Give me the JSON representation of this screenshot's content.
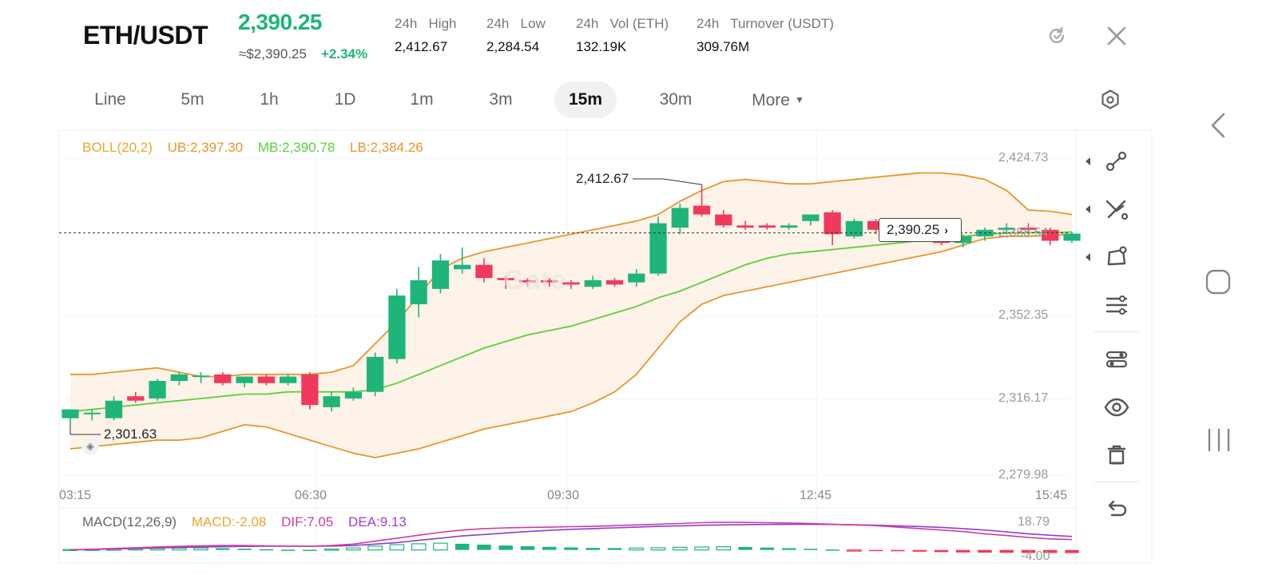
{
  "header": {
    "pair": "ETH/USDT",
    "price": "2,390.25",
    "price_usd": "≈$2,390.25",
    "change": "+2.34%",
    "stats": [
      {
        "label": "24h   High",
        "value": "2,412.67"
      },
      {
        "label": "24h   Low",
        "value": "2,284.54"
      },
      {
        "label": "24h   Vol (ETH)",
        "value": "132.19K"
      },
      {
        "label": "24h   Turnover (USDT)",
        "value": "309.76M"
      }
    ],
    "icons": {
      "refresh": "refresh-icon",
      "close": "close-icon"
    }
  },
  "tabs": [
    {
      "label": "Line",
      "active": false
    },
    {
      "label": "5m",
      "active": false
    },
    {
      "label": "1h",
      "active": false
    },
    {
      "label": "1D",
      "active": false
    },
    {
      "label": "1m",
      "active": false
    },
    {
      "label": "3m",
      "active": false
    },
    {
      "label": "15m",
      "active": true
    },
    {
      "label": "30m",
      "active": false
    },
    {
      "label": "More",
      "active": false
    }
  ],
  "boll": {
    "title": "BOLL(20,2)",
    "ub": "UB:2,397.30",
    "mb": "MB:2,390.78",
    "lb": "LB:2,384.26"
  },
  "macd": {
    "title": "MACD(12,26,9)",
    "macd": "MACD:-2.08",
    "dif": "DIF:7.05",
    "dea": "DEA:9.13",
    "axis_top": "18.79",
    "axis_bottom": "-4.00"
  },
  "price_axis": [
    "2,424.73",
    "2,352.35",
    "2,316.17",
    "2,279.98"
  ],
  "time_axis": [
    "03:15",
    "06:30",
    "09:30",
    "12:45",
    "15:45"
  ],
  "annotations": {
    "high": "2,412.67",
    "low": "2,301.63",
    "current": "2,390.25",
    "current_axis": "2,388.54",
    "watermark": "Gate"
  },
  "colors": {
    "up": "#1fb479",
    "down": "#f0395b",
    "ub": "#e8962a",
    "mb": "#5ccf3a",
    "lb": "#e8962a",
    "band_fill": "#fdf1e5",
    "dif": "#d13aa0",
    "dea": "#8b3fd1",
    "macd_label": "#e8a82a"
  },
  "chart_data": {
    "type": "candlestick",
    "interval": "15m",
    "y_range": [
      2279.98,
      2424.73
    ],
    "candles": [
      {
        "o": 2306,
        "h": 2308,
        "l": 2301.63,
        "c": 2310
      },
      {
        "o": 2308,
        "h": 2310,
        "l": 2305,
        "c": 2308.5
      },
      {
        "o": 2306,
        "h": 2316,
        "l": 2305,
        "c": 2314
      },
      {
        "o": 2316,
        "h": 2318,
        "l": 2313,
        "c": 2314
      },
      {
        "o": 2315,
        "h": 2324,
        "l": 2314,
        "c": 2323
      },
      {
        "o": 2323,
        "h": 2327,
        "l": 2321,
        "c": 2326
      },
      {
        "o": 2325,
        "h": 2327,
        "l": 2322,
        "c": 2325.5
      },
      {
        "o": 2326,
        "h": 2327,
        "l": 2321,
        "c": 2322
      },
      {
        "o": 2322,
        "h": 2325,
        "l": 2320,
        "c": 2325
      },
      {
        "o": 2325,
        "h": 2326,
        "l": 2321,
        "c": 2322
      },
      {
        "o": 2322,
        "h": 2326,
        "l": 2321,
        "c": 2325
      },
      {
        "o": 2326,
        "h": 2327,
        "l": 2310,
        "c": 2312
      },
      {
        "o": 2311,
        "h": 2318,
        "l": 2309,
        "c": 2316
      },
      {
        "o": 2315,
        "h": 2320,
        "l": 2314,
        "c": 2318
      },
      {
        "o": 2318,
        "h": 2336,
        "l": 2316,
        "c": 2334
      },
      {
        "o": 2333,
        "h": 2365,
        "l": 2331,
        "c": 2362
      },
      {
        "o": 2358,
        "h": 2375,
        "l": 2352,
        "c": 2369
      },
      {
        "o": 2365,
        "h": 2381,
        "l": 2363,
        "c": 2378
      },
      {
        "o": 2374,
        "h": 2384,
        "l": 2372,
        "c": 2376
      },
      {
        "o": 2376,
        "h": 2379,
        "l": 2368,
        "c": 2370
      },
      {
        "o": 2370,
        "h": 2371,
        "l": 2365,
        "c": 2369
      },
      {
        "o": 2369,
        "h": 2370,
        "l": 2366,
        "c": 2368
      },
      {
        "o": 2369,
        "h": 2370,
        "l": 2366,
        "c": 2368
      },
      {
        "o": 2368,
        "h": 2369,
        "l": 2365,
        "c": 2367
      },
      {
        "o": 2366,
        "h": 2371,
        "l": 2365,
        "c": 2369
      },
      {
        "o": 2369,
        "h": 2370,
        "l": 2366,
        "c": 2367
      },
      {
        "o": 2368,
        "h": 2374,
        "l": 2366,
        "c": 2372
      },
      {
        "o": 2372,
        "h": 2398,
        "l": 2371,
        "c": 2395
      },
      {
        "o": 2393,
        "h": 2404,
        "l": 2390,
        "c": 2402
      },
      {
        "o": 2403,
        "h": 2412.67,
        "l": 2398,
        "c": 2399
      },
      {
        "o": 2399,
        "h": 2401,
        "l": 2393,
        "c": 2394
      },
      {
        "o": 2394,
        "h": 2396,
        "l": 2392,
        "c": 2393
      },
      {
        "o": 2394,
        "h": 2395,
        "l": 2392,
        "c": 2393
      },
      {
        "o": 2393,
        "h": 2395,
        "l": 2392,
        "c": 2394
      },
      {
        "o": 2396,
        "h": 2399,
        "l": 2394,
        "c": 2399
      },
      {
        "o": 2400,
        "h": 2401,
        "l": 2385,
        "c": 2390
      },
      {
        "o": 2389,
        "h": 2397,
        "l": 2388,
        "c": 2396
      },
      {
        "o": 2396,
        "h": 2397,
        "l": 2390,
        "c": 2392
      },
      {
        "o": 2392,
        "h": 2394,
        "l": 2390,
        "c": 2393
      },
      {
        "o": 2392,
        "h": 2393,
        "l": 2389,
        "c": 2392
      },
      {
        "o": 2392,
        "h": 2393,
        "l": 2385,
        "c": 2386
      },
      {
        "o": 2386,
        "h": 2390,
        "l": 2384,
        "c": 2389
      },
      {
        "o": 2389,
        "h": 2393,
        "l": 2387,
        "c": 2392
      },
      {
        "o": 2392,
        "h": 2395,
        "l": 2390,
        "c": 2393
      },
      {
        "o": 2393,
        "h": 2395,
        "l": 2390,
        "c": 2392
      },
      {
        "o": 2392,
        "h": 2393,
        "l": 2385,
        "c": 2387
      },
      {
        "o": 2387,
        "h": 2391,
        "l": 2386,
        "c": 2390.25
      }
    ],
    "upper_band": [
      2326,
      2326,
      2327,
      2328,
      2329,
      2327,
      2325,
      2325,
      2326,
      2326,
      2326,
      2326,
      2327,
      2330,
      2340,
      2350,
      2362,
      2374,
      2379,
      2382,
      2384,
      2386,
      2388,
      2390,
      2392,
      2394,
      2396,
      2399,
      2405,
      2410,
      2414,
      2415,
      2414,
      2413,
      2413,
      2414,
      2415,
      2416,
      2417,
      2418,
      2418,
      2417,
      2415,
      2410,
      2401,
      2400.5,
      2399
    ],
    "middle_band": [
      2309,
      2310,
      2311,
      2312,
      2313,
      2314,
      2315,
      2316,
      2317,
      2317,
      2318,
      2318,
      2318,
      2318,
      2319,
      2322,
      2326,
      2330,
      2334,
      2338,
      2341,
      2344,
      2346,
      2348,
      2351,
      2354,
      2357,
      2361,
      2364,
      2368,
      2372,
      2376,
      2379,
      2381,
      2382,
      2383,
      2384,
      2385,
      2386,
      2387,
      2388,
      2389,
      2390,
      2390.5,
      2390.8,
      2390.8,
      2391
    ],
    "lower_band": [
      2292,
      2293,
      2294,
      2295,
      2296,
      2296,
      2297,
      2300,
      2303,
      2302,
      2299,
      2296,
      2293,
      2290,
      2288,
      2290,
      2292,
      2295,
      2298,
      2301,
      2303,
      2305,
      2307,
      2309,
      2313,
      2318,
      2326,
      2338,
      2350,
      2358,
      2362,
      2364,
      2366,
      2368,
      2370,
      2372,
      2374,
      2376,
      2378,
      2380,
      2382,
      2385,
      2388,
      2389,
      2389,
      2389.5,
      2390
    ],
    "macd": {
      "y_range": [
        -4.0,
        18.79
      ],
      "dif": [
        0,
        0.5,
        1,
        1.5,
        2,
        2.5,
        2.8,
        3,
        3,
        2.8,
        2.6,
        2.5,
        3,
        4,
        6,
        8,
        10,
        12,
        13.5,
        14.5,
        15,
        15.3,
        15.5,
        15.8,
        16,
        16.5,
        17,
        17.5,
        18,
        18.5,
        18.79,
        18.7,
        18.5,
        18.3,
        18,
        17.5,
        17,
        16.5,
        15.5,
        14.5,
        13.5,
        12.5,
        11,
        9.8,
        8.5,
        7.5,
        7.05
      ],
      "dea": [
        0,
        0.3,
        0.6,
        1,
        1.3,
        1.7,
        2,
        2.2,
        2.4,
        2.5,
        2.5,
        2.5,
        2.6,
        3,
        4,
        5,
        6.5,
        8,
        9.5,
        10.5,
        11.5,
        12.5,
        13.3,
        14,
        14.5,
        15,
        15.5,
        16,
        16.4,
        16.8,
        17,
        17.2,
        17.3,
        17.4,
        17.4,
        17.3,
        17.1,
        16.8,
        16.4,
        15.9,
        15.3,
        14.5,
        13.5,
        12.3,
        11,
        10,
        9.13
      ],
      "hist": [
        0.4,
        0.5,
        0.6,
        0.8,
        1,
        1.2,
        1.3,
        1.2,
        0.9,
        0.5,
        0.2,
        0.1,
        0.6,
        1.4,
        2.6,
        3.6,
        4.2,
        4.6,
        4.2,
        3.6,
        3,
        2.5,
        2.1,
        1.7,
        1.4,
        1.3,
        1.3,
        1.5,
        1.8,
        2,
        2.2,
        2.0,
        1.6,
        1.2,
        0.8,
        0.3,
        -0.1,
        -0.5,
        -0.9,
        -1.2,
        -1.5,
        -1.7,
        -1.8,
        -1.9,
        -2.0,
        -2.05,
        -2.08
      ]
    }
  }
}
